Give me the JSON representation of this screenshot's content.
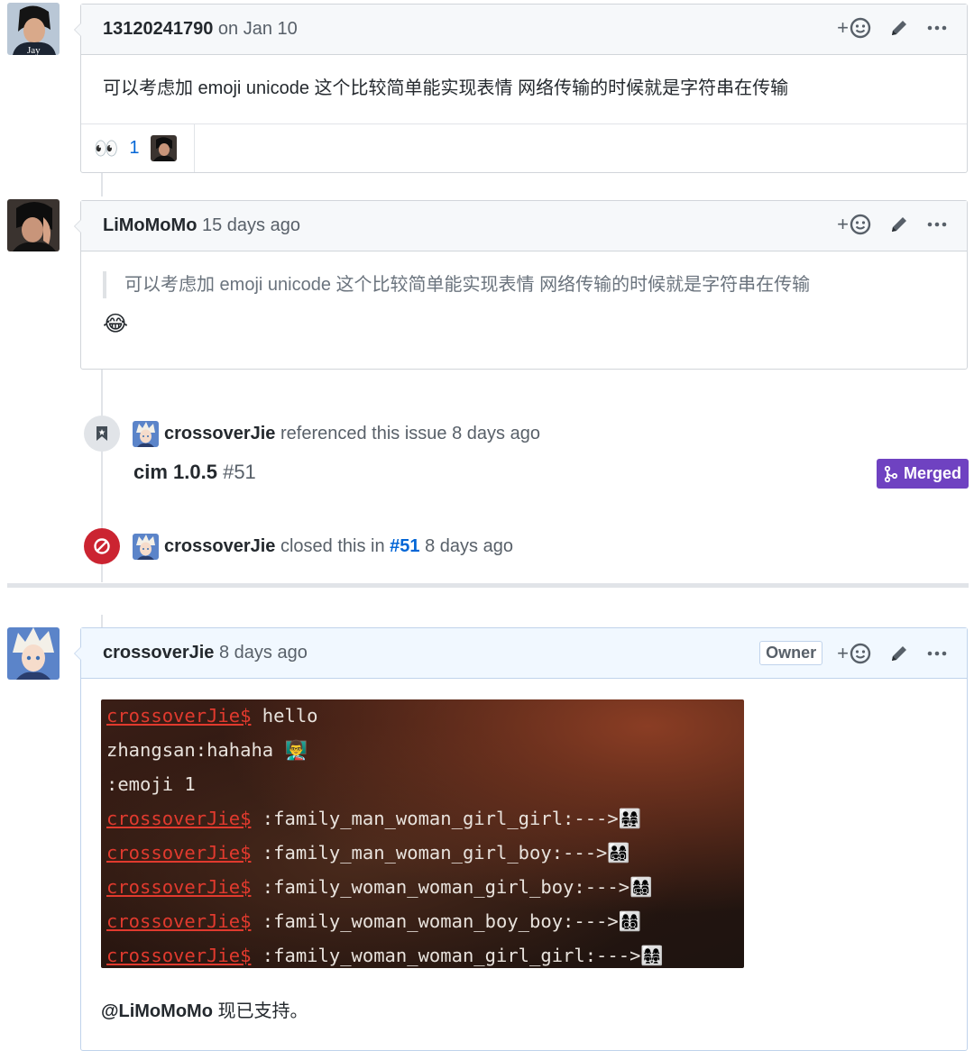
{
  "comments": [
    {
      "author": "13120241790",
      "date": "on Jan 10",
      "body": "可以考虑加 emoji unicode 这个比较简单能实现表情 网络传输的时候就是字符串在传输",
      "reaction": {
        "emoji": "👀",
        "count": "1"
      }
    },
    {
      "author": "LiMoMoMo",
      "date": "15 days ago",
      "quote": "可以考虑加 emoji unicode 这个比较简单能实现表情 网络传输的时候就是字符串在传输",
      "body_emoji": "😂"
    },
    {
      "author": "crossoverJie",
      "date": "8 days ago",
      "owner_badge": "Owner",
      "closing_mention": "@LiMoMoMo",
      "closing_text": " 现已支持。"
    }
  ],
  "events": {
    "reference": {
      "actor": "crossoverJie",
      "text": "referenced this issue",
      "date": "8 days ago",
      "pr_title": "cim 1.0.5",
      "pr_number": "#51",
      "state": "Merged"
    },
    "closed": {
      "actor": "crossoverJie",
      "text": "closed this in",
      "link": "#51",
      "date": "8 days ago"
    }
  },
  "terminal": [
    {
      "prompt": "crossoverJie$",
      "text": " hello"
    },
    {
      "prompt": "",
      "text": "zhangsan:hahaha 👨‍🏫"
    },
    {
      "prompt": "",
      "text": ":emoji 1"
    },
    {
      "prompt": "crossoverJie$",
      "text": " :family_man_woman_girl_girl:--->👨‍👩‍👧‍👧"
    },
    {
      "prompt": "crossoverJie$",
      "text": " :family_man_woman_girl_boy:--->👨‍👩‍👧‍👦"
    },
    {
      "prompt": "crossoverJie$",
      "text": " :family_woman_woman_girl_boy:--->👩‍👩‍👧‍👦"
    },
    {
      "prompt": "crossoverJie$",
      "text": " :family_woman_woman_boy_boy:--->👩‍👩‍👦‍👦"
    },
    {
      "prompt": "crossoverJie$",
      "text": " :family_woman_woman_girl_girl:--->👩‍👩‍👧‍👧"
    }
  ],
  "icons": {
    "add_reaction": "smiley-icon",
    "edit": "pencil-icon",
    "more": "kebab-horizontal-icon",
    "reference": "bookmark-icon",
    "closed": "circle-slash-icon",
    "merged": "git-merge-icon"
  },
  "colors": {
    "link": "#0366d6",
    "merged": "#6f42c1",
    "closed": "#cb2431"
  }
}
